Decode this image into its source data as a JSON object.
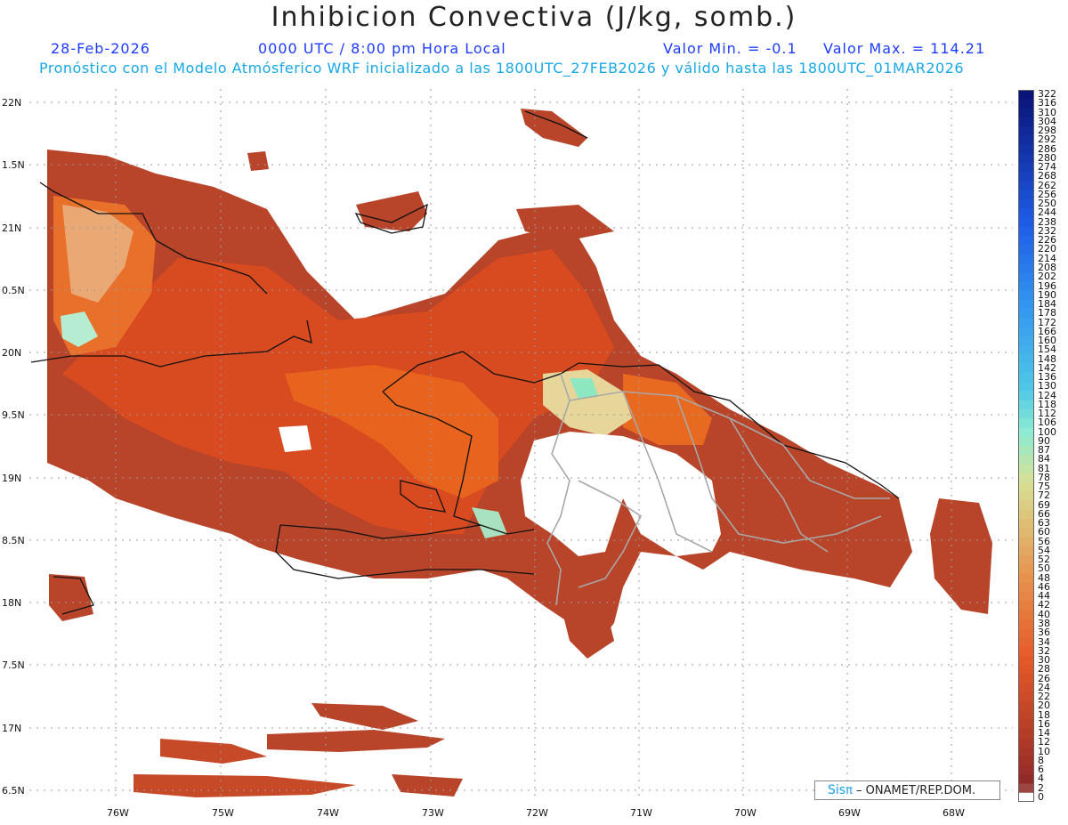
{
  "header": {
    "title": "Inhibicion Convectiva (J/kg, somb.)",
    "date": "28-Feb-2026",
    "time": "0000 UTC / 8:00 pm Hora Local",
    "min_label": "Valor Min. = -0.1",
    "max_label": "Valor Max. = 114.21",
    "subtitle": "Pronóstico con el Modelo Atmósferico WRF inicializado a las 1800UTC_27FEB2026 y válido hasta las  1800UTC_01MAR2026"
  },
  "map": {
    "lat_labels": [
      "22N",
      "1.5N",
      "21N",
      "0.5N",
      "20N",
      "9.5N",
      "19N",
      "8.5N",
      "18N",
      "7.5N",
      "17N",
      "6.5N"
    ],
    "lon_labels": [
      "76W",
      "75W",
      "74W",
      "73W",
      "72W",
      "71W",
      "70W",
      "69W",
      "68W"
    ],
    "grid": true,
    "fill_color": "#b8452a",
    "hot_color": "#e8551c",
    "high_color": "#8de8c2",
    "coast_color": "#111111",
    "border_color": "#a8a8a8"
  },
  "credit": {
    "brand": "Sis",
    "pi": "π",
    "org": "– ONAMET/REP.DOM."
  },
  "colorbar": {
    "labels": [
      "322",
      "316",
      "310",
      "304",
      "298",
      "292",
      "286",
      "280",
      "274",
      "268",
      "262",
      "256",
      "250",
      "244",
      "238",
      "232",
      "226",
      "220",
      "214",
      "208",
      "202",
      "196",
      "190",
      "184",
      "178",
      "172",
      "166",
      "160",
      "154",
      "148",
      "142",
      "136",
      "130",
      "124",
      "118",
      "112",
      "106",
      "100",
      "90",
      "87",
      "84",
      "81",
      "78",
      "75",
      "72",
      "69",
      "66",
      "63",
      "60",
      "56",
      "54",
      "52",
      "50",
      "48",
      "46",
      "44",
      "42",
      "40",
      "38",
      "36",
      "34",
      "32",
      "30",
      "28",
      "26",
      "24",
      "22",
      "20",
      "18",
      "16",
      "14",
      "12",
      "10",
      "8",
      "6",
      "4",
      "2",
      "0"
    ]
  }
}
